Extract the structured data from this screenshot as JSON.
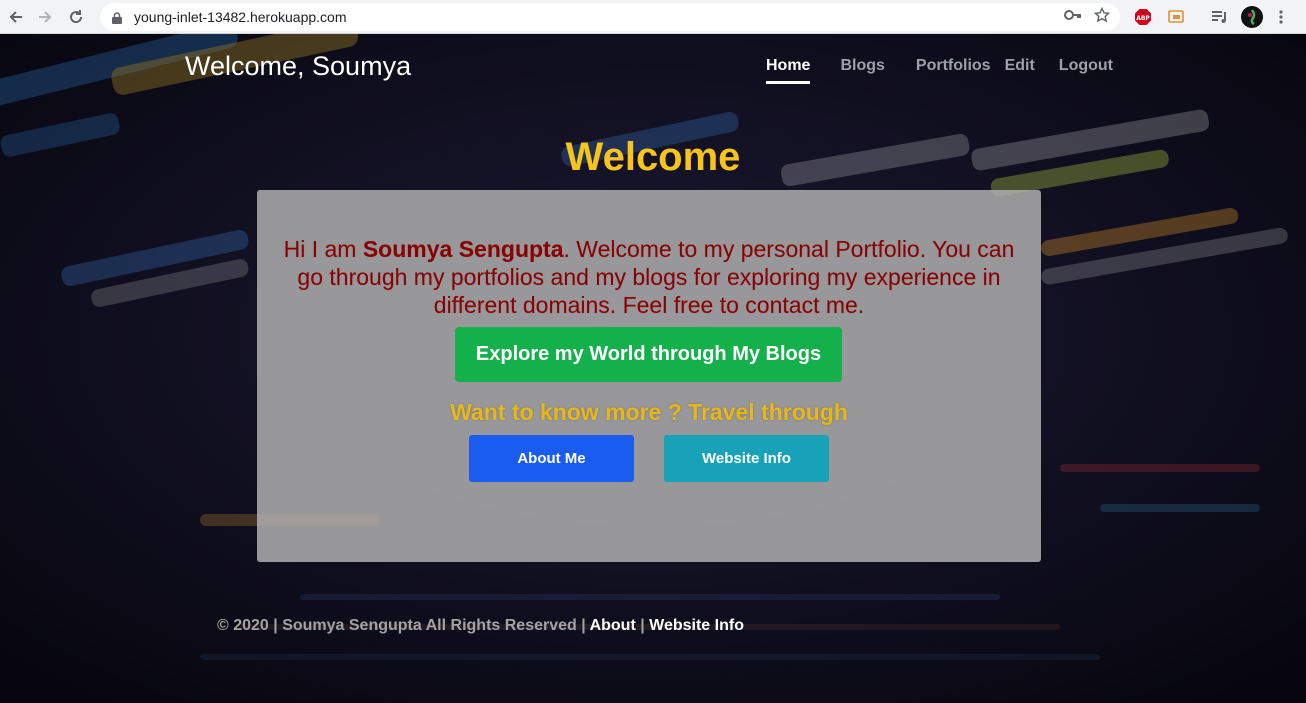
{
  "browser": {
    "url": "young-inlet-13482.herokuapp.com",
    "ext_badge": "ABP"
  },
  "site": {
    "brand": "Welcome, Soumya",
    "nav": [
      {
        "label": "Home",
        "active": true
      },
      {
        "label": "Blogs",
        "active": false
      },
      {
        "label": "Portfolios",
        "active": false
      },
      {
        "label": "Edit",
        "active": false
      },
      {
        "label": "Logout",
        "active": false
      }
    ]
  },
  "hero": {
    "heading": "Welcome",
    "intro_prefix": "Hi I am ",
    "intro_name": "Soumya Sengupta",
    "intro_rest": ". Welcome to my personal Portfolio. You can go through my portfolios and my blogs for exploring my experience in different domains. Feel free to contact me.",
    "blog_button": "Explore my World through My Blogs",
    "travel_text": "Want to know more ? Travel through",
    "about_button": "About Me",
    "info_button": "Website Info"
  },
  "footer": {
    "text": "© 2020 | Soumya Sengupta All Rights Reserved | ",
    "about_link": "About",
    "separator": " | ",
    "info_link": "Website Info"
  },
  "colors": {
    "accent_yellow": "#f7c41c",
    "intro_red": "#8b0000",
    "green": "#13b04b",
    "blue": "#1a5cf0",
    "teal": "#17a2b8"
  }
}
